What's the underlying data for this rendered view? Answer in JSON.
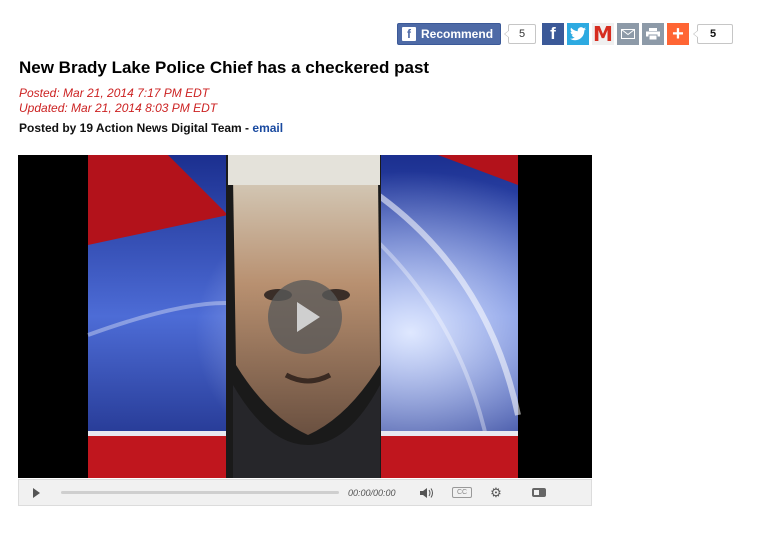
{
  "share": {
    "recommend_label": "Recommend",
    "recommend_count": "5",
    "share_count": "5",
    "icons": [
      "facebook-icon",
      "twitter-icon",
      "gmail-icon",
      "email-icon",
      "print-icon",
      "addthis-plus-icon"
    ]
  },
  "article": {
    "headline": "New Brady Lake Police Chief has a checkered past",
    "posted": "Posted: Mar 21, 2014 7:17 PM EDT",
    "updated": "Updated: Mar 21, 2014 8:03 PM EDT",
    "byline_prefix": "Posted by 19 Action News Digital Team - ",
    "byline_link": "email"
  },
  "video": {
    "time_display": "00:00/00:00"
  },
  "colors": {
    "date_red": "#cc2222",
    "link_blue": "#1a4aa0",
    "facebook_blue": "#3b5998"
  }
}
